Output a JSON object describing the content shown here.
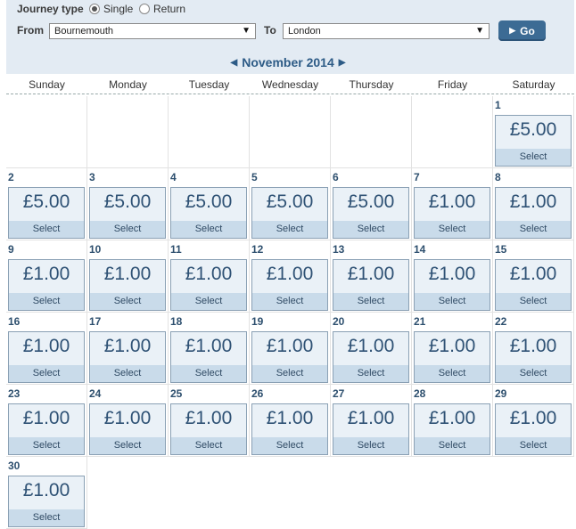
{
  "journey": {
    "type_label": "Journey type",
    "options": [
      "Single",
      "Return"
    ],
    "selected": "Single"
  },
  "from": {
    "label": "From",
    "value": "Bournemouth"
  },
  "to": {
    "label": "To",
    "value": "London"
  },
  "go_label": "Go",
  "month_label": "November 2014",
  "day_headers": [
    "Sunday",
    "Monday",
    "Tuesday",
    "Wednesday",
    "Thursday",
    "Friday",
    "Saturday"
  ],
  "select_label": "Select",
  "days": [
    {
      "day": "1",
      "price": "£5.00"
    },
    {
      "day": "2",
      "price": "£5.00"
    },
    {
      "day": "3",
      "price": "£5.00"
    },
    {
      "day": "4",
      "price": "£5.00"
    },
    {
      "day": "5",
      "price": "£5.00"
    },
    {
      "day": "6",
      "price": "£5.00"
    },
    {
      "day": "7",
      "price": "£1.00"
    },
    {
      "day": "8",
      "price": "£1.00"
    },
    {
      "day": "9",
      "price": "£1.00"
    },
    {
      "day": "10",
      "price": "£1.00"
    },
    {
      "day": "11",
      "price": "£1.00"
    },
    {
      "day": "12",
      "price": "£1.00"
    },
    {
      "day": "13",
      "price": "£1.00"
    },
    {
      "day": "14",
      "price": "£1.00"
    },
    {
      "day": "15",
      "price": "£1.00"
    },
    {
      "day": "16",
      "price": "£1.00"
    },
    {
      "day": "17",
      "price": "£1.00"
    },
    {
      "day": "18",
      "price": "£1.00"
    },
    {
      "day": "19",
      "price": "£1.00"
    },
    {
      "day": "20",
      "price": "£1.00"
    },
    {
      "day": "21",
      "price": "£1.00"
    },
    {
      "day": "22",
      "price": "£1.00"
    },
    {
      "day": "23",
      "price": "£1.00"
    },
    {
      "day": "24",
      "price": "£1.00"
    },
    {
      "day": "25",
      "price": "£1.00"
    },
    {
      "day": "26",
      "price": "£1.00"
    },
    {
      "day": "27",
      "price": "£1.00"
    },
    {
      "day": "28",
      "price": "£1.00"
    },
    {
      "day": "29",
      "price": "£1.00"
    },
    {
      "day": "30",
      "price": "£1.00"
    }
  ]
}
